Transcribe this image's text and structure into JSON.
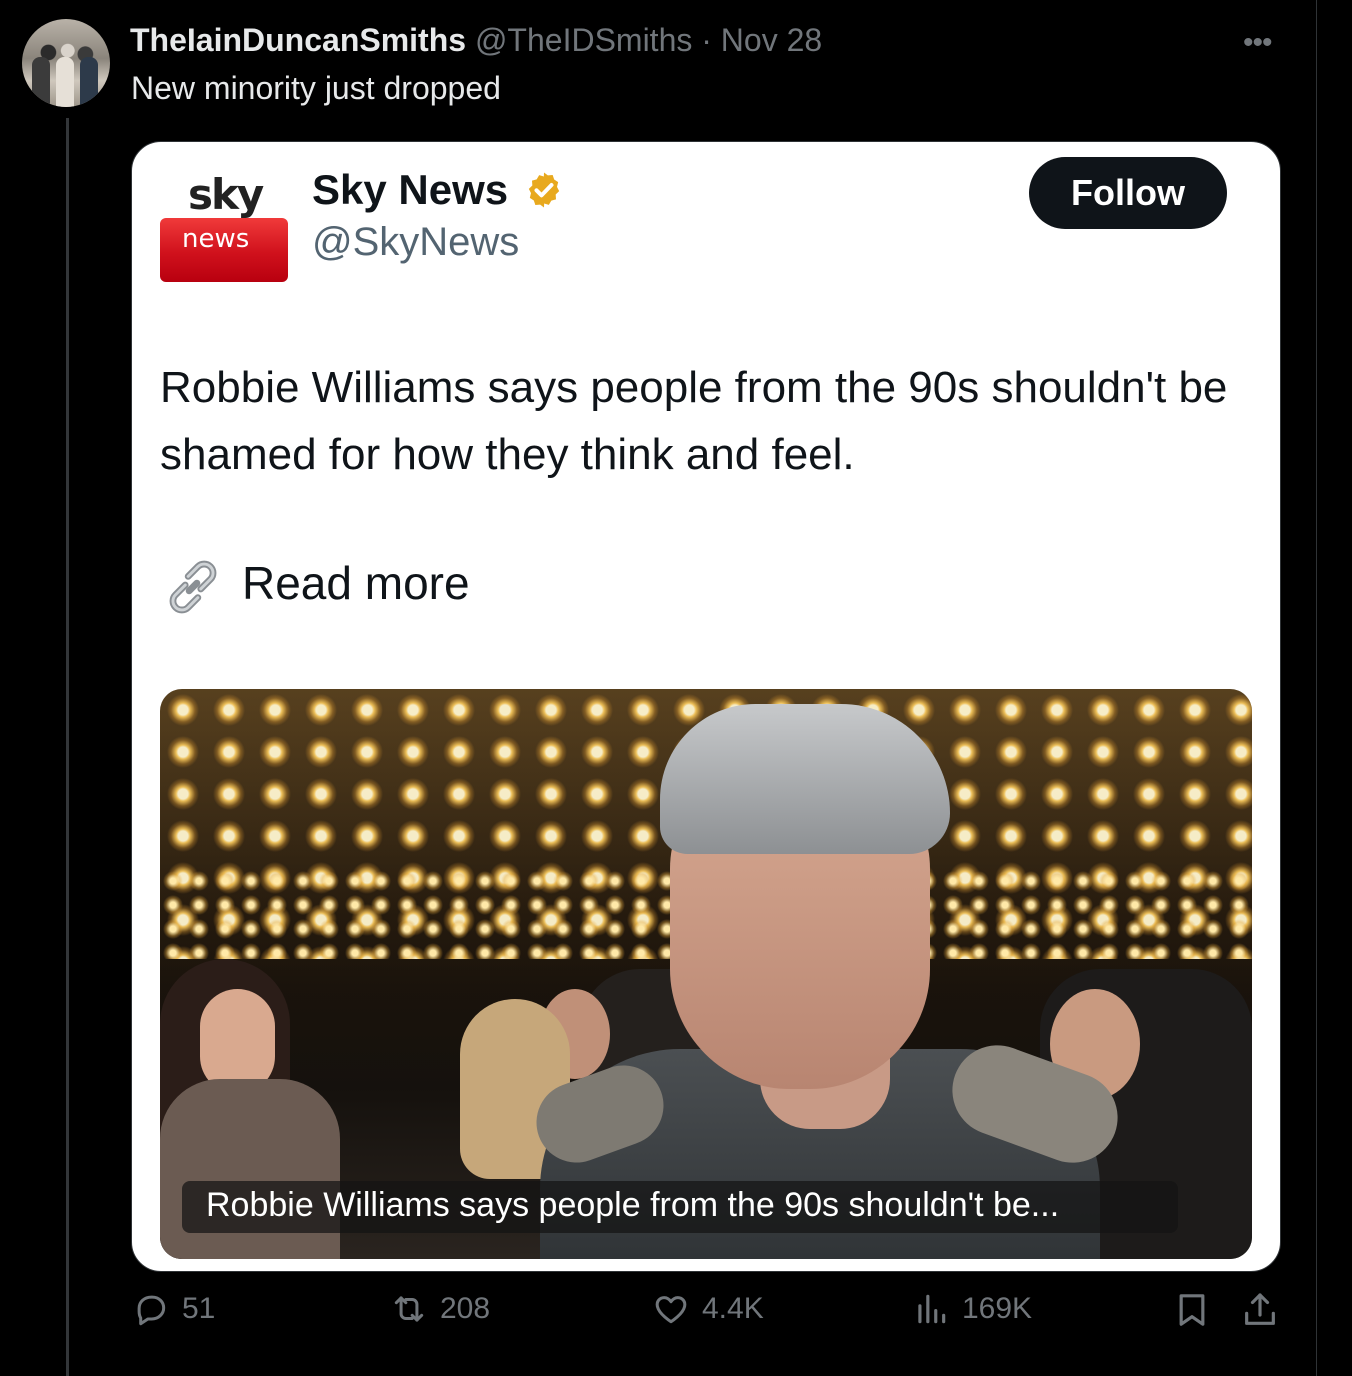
{
  "tweet": {
    "display_name": "TheIainDuncanSmiths",
    "handle": "@TheIDSmiths",
    "separator": "·",
    "date": "Nov 28",
    "text": "New minority just dropped",
    "more_icon": "more-dots-icon"
  },
  "quoted_card": {
    "logo": {
      "sky": "sky",
      "news": "news"
    },
    "account_name": "Sky News",
    "account_handle": "@SkyNews",
    "verified_color": "#e8a91e",
    "follow_label": "Follow",
    "text": "Robbie Williams says people from the 90s shouldn't be shamed for how they think and feel.",
    "link_label": "Read more",
    "link_icon": "link-icon",
    "image_caption": "Robbie Williams says people from the 90s shouldn't be..."
  },
  "actions": {
    "replies": "51",
    "reposts": "208",
    "likes": "4.4K",
    "views": "169K"
  },
  "colors": {
    "background": "#000000",
    "muted": "#71767b",
    "card": "#ffffff",
    "follow_button": "#0f1419"
  }
}
